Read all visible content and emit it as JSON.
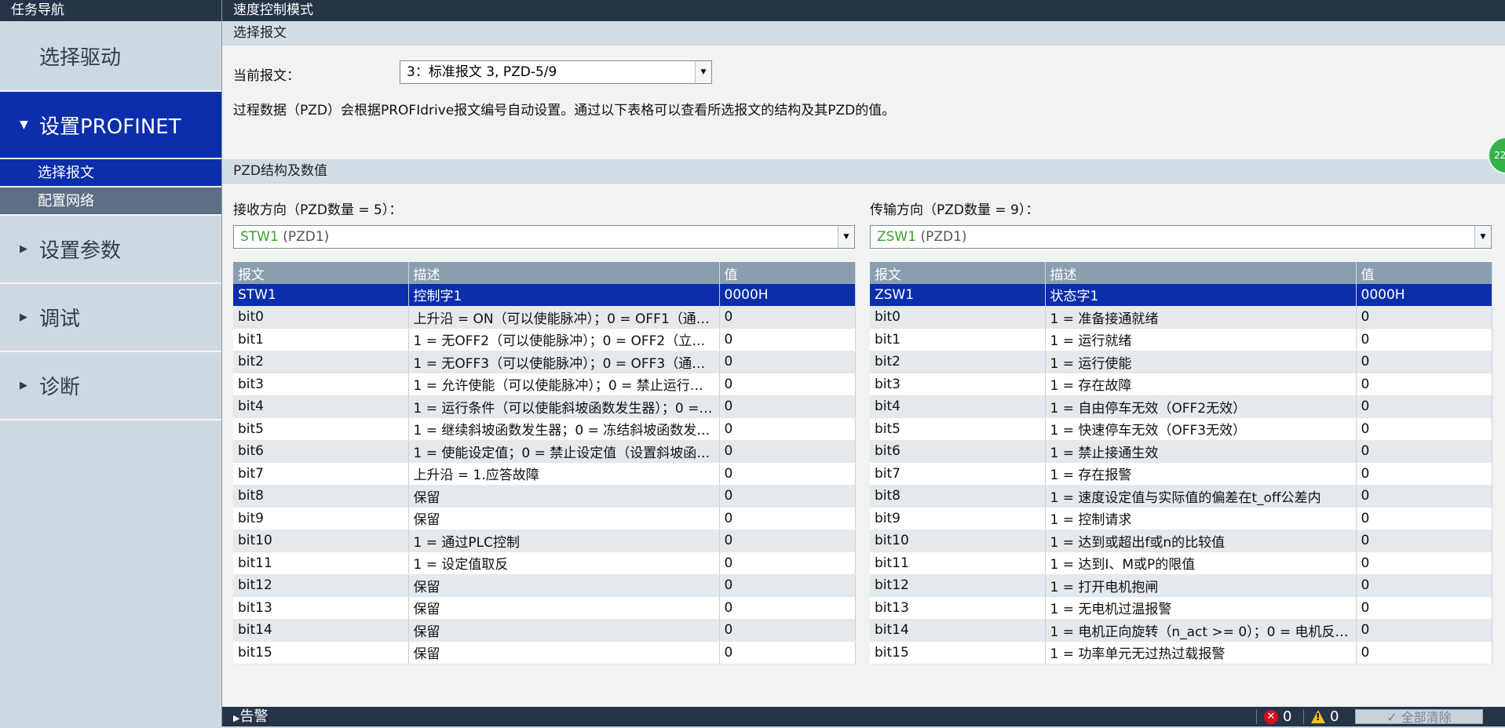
{
  "sidebar": {
    "header": "任务导航",
    "items": [
      {
        "label": "选择驱动"
      },
      {
        "label": "设置PROFINET"
      },
      {
        "label": "设置参数"
      },
      {
        "label": "调试"
      },
      {
        "label": "诊断"
      }
    ],
    "sub_items": [
      {
        "label": "选择报文"
      },
      {
        "label": "配置网络"
      }
    ]
  },
  "main": {
    "title": "速度控制模式",
    "section1": "选择报文",
    "current_label": "当前报文：",
    "current_value": "3：标准报文 3, PZD-5/9",
    "info": "过程数据（PZD）会根据PROFIdrive报文编号自动设置。通过以下表格可以查看所选报文的结构及其PZD的值。",
    "section2": "PZD结构及数值",
    "receive": {
      "label": "接收方向（PZD数量 = 5）：",
      "select_name": "STW1",
      "select_pzd": "(PZD1)",
      "headers": [
        "报文",
        "描述",
        "值"
      ],
      "rows": [
        [
          "STW1",
          "控制字1",
          "0000H"
        ],
        [
          "bit0",
          "上升沿 = ON（可以使能脉冲）；0 = OFF1（通…",
          "0"
        ],
        [
          "bit1",
          "1 = 无OFF2（可以使能脉冲）；0 = OFF2（立…",
          "0"
        ],
        [
          "bit2",
          "1 = 无OFF3（可以使能脉冲）；0 = OFF3（通…",
          "0"
        ],
        [
          "bit3",
          "1 = 允许使能（可以使能脉冲）；0 = 禁止运行…",
          "0"
        ],
        [
          "bit4",
          "1 = 运行条件（可以使能斜坡函数发生器）；0 =…",
          "0"
        ],
        [
          "bit5",
          "1 = 继续斜坡函数发生器；0 = 冻结斜坡函数发…",
          "0"
        ],
        [
          "bit6",
          "1 = 使能设定值；0 = 禁止设定值（设置斜坡函…",
          "0"
        ],
        [
          "bit7",
          "上升沿 = 1.应答故障",
          "0"
        ],
        [
          "bit8",
          "保留",
          "0"
        ],
        [
          "bit9",
          "保留",
          "0"
        ],
        [
          "bit10",
          "1 = 通过PLC控制",
          "0"
        ],
        [
          "bit11",
          "1 = 设定值取反",
          "0"
        ],
        [
          "bit12",
          "保留",
          "0"
        ],
        [
          "bit13",
          "保留",
          "0"
        ],
        [
          "bit14",
          "保留",
          "0"
        ],
        [
          "bit15",
          "保留",
          "0"
        ]
      ]
    },
    "transmit": {
      "label": "传输方向（PZD数量 = 9）：",
      "select_name": "ZSW1",
      "select_pzd": "(PZD1)",
      "headers": [
        "报文",
        "描述",
        "值"
      ],
      "rows": [
        [
          "ZSW1",
          "状态字1",
          "0000H"
        ],
        [
          "bit0",
          "1 = 准备接通就绪",
          "0"
        ],
        [
          "bit1",
          "1 = 运行就绪",
          "0"
        ],
        [
          "bit2",
          "1 = 运行使能",
          "0"
        ],
        [
          "bit3",
          "1 = 存在故障",
          "0"
        ],
        [
          "bit4",
          "1 = 自由停车无效（OFF2无效）",
          "0"
        ],
        [
          "bit5",
          "1 = 快速停车无效（OFF3无效）",
          "0"
        ],
        [
          "bit6",
          "1 = 禁止接通生效",
          "0"
        ],
        [
          "bit7",
          "1 = 存在报警",
          "0"
        ],
        [
          "bit8",
          "1 = 速度设定值与实际值的偏差在t_off公差内",
          "0"
        ],
        [
          "bit9",
          "1 = 控制请求",
          "0"
        ],
        [
          "bit10",
          "1 = 达到或超出f或n的比较值",
          "0"
        ],
        [
          "bit11",
          "1 = 达到I、M或P的限值",
          "0"
        ],
        [
          "bit12",
          "1 = 打开电机抱闸",
          "0"
        ],
        [
          "bit13",
          "1 = 无电机过温报警",
          "0"
        ],
        [
          "bit14",
          "1 = 电机正向旋转（n_act >= 0）；0 = 电机反…",
          "0"
        ],
        [
          "bit15",
          "1 = 功率单元无过热过载报警",
          "0"
        ]
      ]
    }
  },
  "footer": {
    "alarm": "告警",
    "error_count": "0",
    "warning_count": "0",
    "clear_all": "全部清除"
  },
  "badge": "22"
}
